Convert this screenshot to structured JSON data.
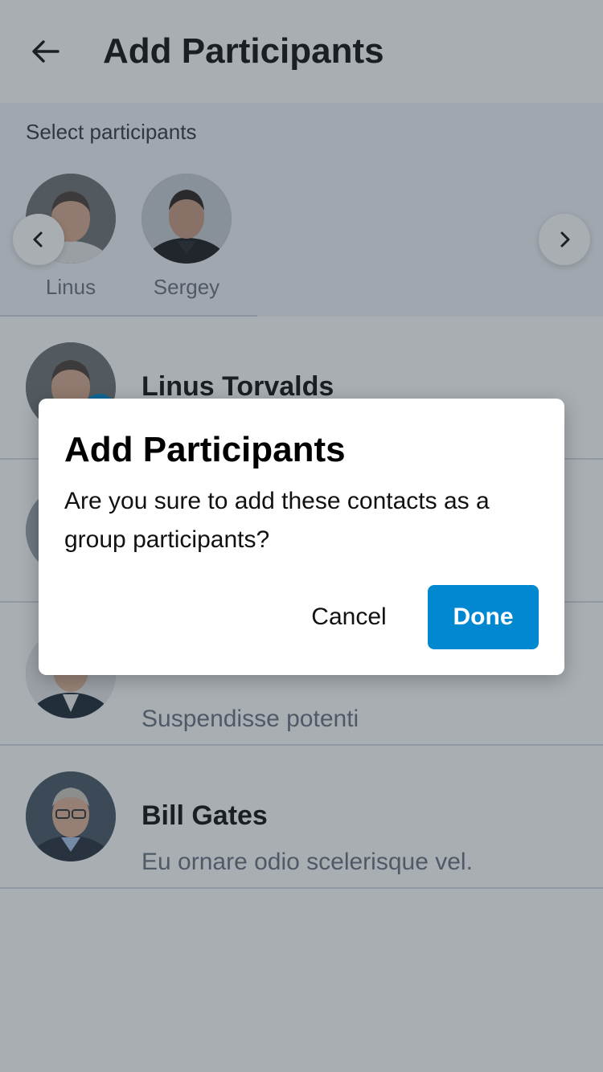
{
  "header": {
    "title": "Add Participants",
    "back_icon": "arrow-left-icon"
  },
  "selected": {
    "label": "Select participants",
    "chips": [
      {
        "name": "Linus"
      },
      {
        "name": "Sergey"
      }
    ],
    "prev_icon": "chevron-left-icon",
    "next_icon": "chevron-right-icon"
  },
  "contacts": [
    {
      "name": "Linus Torvalds",
      "message": "",
      "selected": true
    },
    {
      "name": "",
      "message": "",
      "selected": false
    },
    {
      "name": "",
      "message": "Suspendisse potenti",
      "selected": false
    },
    {
      "name": "Bill Gates",
      "message": "Eu ornare odio scelerisque vel.",
      "selected": false
    }
  ],
  "dialog": {
    "title": "Add Participants",
    "body": "Are you sure to add these contacts as a group participants?",
    "cancel_label": "Cancel",
    "done_label": "Done"
  },
  "colors": {
    "accent": "#0288d1",
    "scrim": "#28344266"
  }
}
